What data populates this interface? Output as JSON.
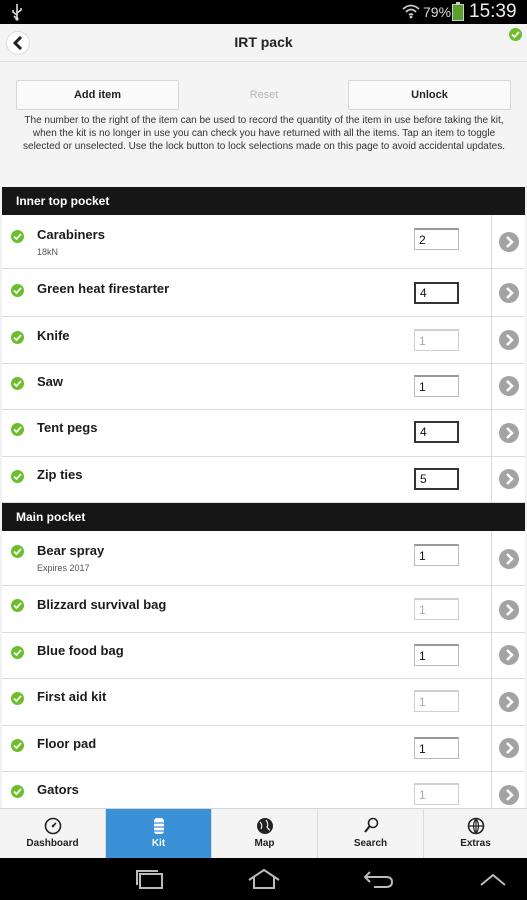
{
  "status_bar": {
    "battery_percent": "79%",
    "time": "15:39",
    "icons": [
      "usb-icon",
      "wifi-icon",
      "battery-icon"
    ]
  },
  "header": {
    "title": "IRT pack",
    "back_icon": "chevron-left-icon",
    "sync_icon": "check-circle-icon"
  },
  "actions": {
    "add_label": "Add item",
    "reset_label": "Reset",
    "unlock_label": "Unlock",
    "help_text": "The number to the right of the item can be used to record the quantity of the item in use before taking the kit, when the kit is no longer in use you can check you have returned with all the items. Tap an item to toggle selected or unselected. Use the lock button to lock selections made on this page to avoid accidental updates."
  },
  "sections": [
    {
      "title": "Inner top pocket",
      "items": [
        {
          "name": "Carabiners",
          "sub": "18kN",
          "qty": "2"
        },
        {
          "name": "Green heat firestarter",
          "sub": "",
          "qty": "4"
        },
        {
          "name": "Knife",
          "sub": "",
          "qty": "1"
        },
        {
          "name": "Saw",
          "sub": "",
          "qty": "1"
        },
        {
          "name": "Tent pegs",
          "sub": "",
          "qty": "4"
        },
        {
          "name": "Zip ties",
          "sub": "",
          "qty": "5"
        }
      ]
    },
    {
      "title": "Main pocket",
      "items": [
        {
          "name": "Bear spray",
          "sub": "Expires 2017",
          "qty": "1"
        },
        {
          "name": "Blizzard survival bag",
          "sub": "",
          "qty": "1"
        },
        {
          "name": "Blue food bag",
          "sub": "",
          "qty": "1"
        },
        {
          "name": "First aid kit",
          "sub": "",
          "qty": "1"
        },
        {
          "name": "Floor pad",
          "sub": "",
          "qty": "1"
        },
        {
          "name": "Gators",
          "sub": "",
          "qty": "1"
        }
      ]
    }
  ],
  "tabs": [
    {
      "label": "Dashboard",
      "icon": "dashboard-icon",
      "active": false
    },
    {
      "label": "Kit",
      "icon": "kit-icon",
      "active": true
    },
    {
      "label": "Map",
      "icon": "map-icon",
      "active": false
    },
    {
      "label": "Search",
      "icon": "search-icon",
      "active": false
    },
    {
      "label": "Extras",
      "icon": "extras-icon",
      "active": false
    }
  ],
  "colors": {
    "accent": "#3a91d5",
    "check": "#6cbf2a",
    "section_header": "#161616"
  }
}
